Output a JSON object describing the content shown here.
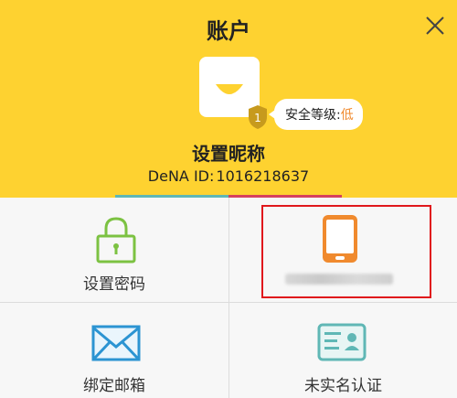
{
  "header": {
    "title": "账户",
    "nickname": "设置昵称",
    "id_prefix": "DeNA ID:",
    "id_value": "1016218637",
    "security_level_prefix": "安全等级:",
    "security_level_value": "低",
    "security_badge": "1"
  },
  "tiles": {
    "set_password": "设置密码",
    "bind_email": "绑定邮箱",
    "real_name": "未实名认证"
  },
  "colors": {
    "header_bg": "#fed230",
    "accent_green": "#7cc242",
    "accent_orange": "#f08a2e",
    "accent_blue": "#2c94d2",
    "accent_teal": "#5fb7b5",
    "highlight_red": "#e0181c"
  },
  "icons": {
    "close": "close-icon",
    "lock": "lock-icon",
    "phone": "phone-icon",
    "mail": "mail-icon",
    "id_card": "id-card-icon",
    "shield": "shield-icon"
  }
}
